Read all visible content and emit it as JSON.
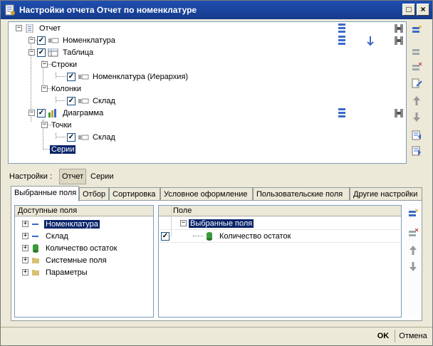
{
  "window": {
    "title": "Настройки отчета  Отчет по номенклатуре"
  },
  "structure_tree": {
    "root": "Отчет",
    "items": [
      {
        "label": "Номенклатура"
      },
      {
        "label": "Таблица"
      },
      {
        "label": "Строки"
      },
      {
        "label": "Номенклатура (Иерархия)"
      },
      {
        "label": "Колонки"
      },
      {
        "label": "Склад"
      },
      {
        "label": "Диаграмма"
      },
      {
        "label": "Точки"
      },
      {
        "label": "Склад"
      },
      {
        "label": "Серии"
      }
    ]
  },
  "settings_switch": {
    "label": "Настройки :",
    "options": [
      "Отчет",
      "Серии"
    ]
  },
  "tabs": [
    "Выбранные поля",
    "Отбор",
    "Сортировка",
    "Условное оформление",
    "Пользовательские поля",
    "Другие настройки"
  ],
  "available_fields": {
    "header": "Доступные поля",
    "items": [
      "Номенклатура",
      "Склад",
      "Количество остаток",
      "Системные поля",
      "Параметры"
    ]
  },
  "selected_fields": {
    "header": "Поле",
    "group": "Выбранные поля",
    "items": [
      "Количество остаток"
    ]
  },
  "footer": {
    "ok": "OK",
    "cancel": "Отмена"
  }
}
